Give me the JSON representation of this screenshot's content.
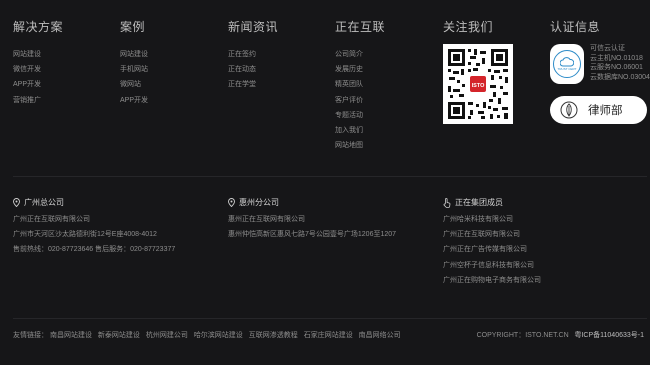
{
  "columns": [
    {
      "title": "解决方案",
      "items": [
        "网站建设",
        "微信开发",
        "APP开发",
        "营销推广"
      ]
    },
    {
      "title": "案例",
      "items": [
        "网站建设",
        "手机网站",
        "微网站",
        "APP开发"
      ]
    },
    {
      "title": "新闻资讯",
      "items": [
        "正在签约",
        "正在动态",
        "正在学堂"
      ]
    },
    {
      "title": "正在互联",
      "items": [
        "公司简介",
        "发展历史",
        "精英团队",
        "客户评价",
        "专题活动",
        "加入我们",
        "网站地图"
      ]
    }
  ],
  "follow": {
    "title": "关注我们",
    "qr_label": "ISTO"
  },
  "cert": {
    "title": "认证信息",
    "badge_text": "TRUST CERT",
    "lines": [
      "可信云认证",
      "云主机NO.01018",
      "云服务NO.06001",
      "云数据库NO.03004"
    ],
    "lawyer_label": "律师部"
  },
  "offices": [
    {
      "name": "广州总公司",
      "icon": "location-pin-icon",
      "lines": [
        "广州正在互联网有限公司",
        "广州市天河区沙太路德利街12号E座4008-4012",
        "售前热线：020-87723646   售后服务：020-87723377"
      ]
    },
    {
      "name": "惠州分公司",
      "icon": "location-pin-icon",
      "lines": [
        "惠州正在互联网有限公司",
        "惠州仲恺高新区惠风七路7号公园壹号广场1206至1207"
      ]
    },
    {
      "name": "正在集团成员",
      "icon": "hand-pointer-icon",
      "lines": [
        "广州哈米科技有限公司",
        "广州正在互联网有限公司",
        "广州正在广告传媒有限公司",
        "广州空杯子信息科技有限公司",
        "广州正在购物电子商务有限公司"
      ]
    }
  ],
  "friend_links": {
    "label": "友情链接：",
    "links": [
      "南昌网站建设",
      "新泰网站建设",
      "杭州网建公司",
      "哈尔滨网站建设",
      "互联网渗透教程",
      "石家庄网站建设",
      "南昌网络公司"
    ]
  },
  "copyright": {
    "text": "COPYRIGHT：ISTO.NET.CN",
    "icp": "粤ICP备11040633号-1"
  },
  "colors": {
    "background": "#161618",
    "text": "#8d8d8d",
    "heading": "#bdbdbd"
  }
}
